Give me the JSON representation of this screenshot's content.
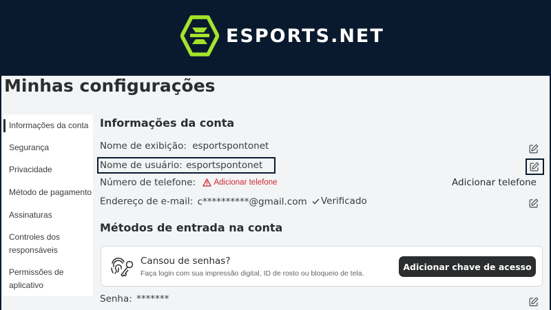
{
  "brand": {
    "name": "ESPORTS.NET",
    "accent_color": "#a4e32b",
    "background_color": "#0a1a2e"
  },
  "page": {
    "title": "Minhas configurações"
  },
  "sidebar": {
    "items": [
      {
        "label": "Informações da conta",
        "active": true
      },
      {
        "label": "Segurança"
      },
      {
        "label": "Privacidade"
      },
      {
        "label": "Método de pagamento"
      },
      {
        "label": "Assinaturas"
      },
      {
        "label": "Controles dos responsáveis"
      },
      {
        "label": "Permissões de aplicativo"
      }
    ]
  },
  "account_info": {
    "title": "Informações da conta",
    "display_name": {
      "label": "Nome de exibição:",
      "value": "esportspontonet"
    },
    "username": {
      "label": "Nome de usuário:",
      "value": "esportspontonet"
    },
    "phone": {
      "label": "Número de telefone:",
      "warning": "Adicionar telefone",
      "action": "Adicionar telefone"
    },
    "email": {
      "label": "Endereço de e-mail:",
      "value": "c**********@gmail.com",
      "status": "Verificado"
    }
  },
  "sign_in_methods": {
    "title": "Métodos de entrada na conta",
    "passkey_card": {
      "title": "Cansou de senhas?",
      "subtitle": "Faça login com sua impressão digital, ID de rosto ou bloqueio de tela.",
      "button_label": "Adicionar chave de acesso"
    },
    "password": {
      "label": "Senha:",
      "value": "*******"
    }
  },
  "icons": {
    "edit": "pencil-square-icon",
    "warning": "warning-triangle-icon",
    "verified": "checkmark-icon",
    "passkey": "fingerprint-key-icon"
  },
  "colors": {
    "warning": "#d0282e",
    "button_bg": "#2b2d2f"
  }
}
